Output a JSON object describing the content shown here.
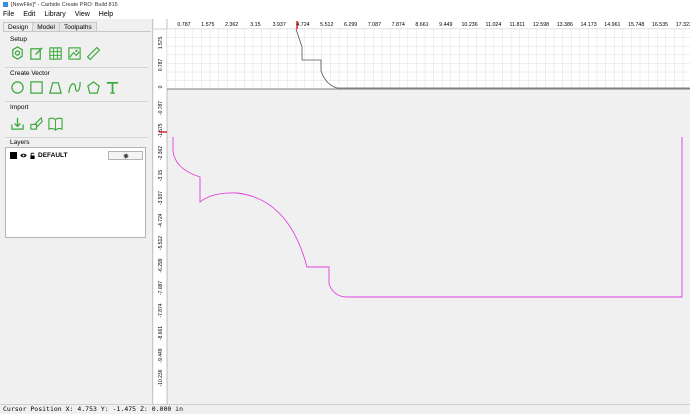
{
  "window": {
    "title": "[NewFile]* - Carbide Create PRO: Build 815"
  },
  "menu": [
    "File",
    "Edit",
    "Library",
    "View",
    "Help"
  ],
  "left_panel": {
    "tabs": [
      {
        "label": "Design",
        "active": true
      },
      {
        "label": "Model",
        "active": false
      },
      {
        "label": "Toolpaths",
        "active": false
      }
    ],
    "sections": {
      "setup": {
        "label": "Setup",
        "icons": [
          "job-setup-icon",
          "edit-icon",
          "grid-table-icon",
          "image-icon",
          "ruler-icon"
        ]
      },
      "create_vector": {
        "label": "Create Vector",
        "icons": [
          "circle-icon",
          "rectangle-icon",
          "polyline-icon",
          "curve-icon",
          "polygon-icon",
          "text-icon"
        ]
      },
      "import": {
        "label": "Import",
        "icons": [
          "import-icon",
          "trace-icon",
          "library-icon"
        ]
      },
      "layers": {
        "label": "Layers",
        "items": [
          {
            "name": "DEFAULT",
            "color": "#000000"
          }
        ]
      }
    }
  },
  "canvas": {
    "x_ruler_labels": [
      "0.787",
      "1.575",
      "2.362",
      "3.15",
      "3.937",
      "4.724",
      "5.512",
      "6.299",
      "7.087",
      "7.874",
      "8.661",
      "9.449",
      "10.236",
      "11.024",
      "11.811",
      "12.598",
      "13.386",
      "14.173",
      "14.961",
      "15.748",
      "16.535",
      "17.323"
    ],
    "y_ruler_labels_top": [
      "1.575",
      "0.787",
      "0"
    ],
    "y_ruler_labels_main": [
      "-0.787",
      "-1.575",
      "-2.362",
      "-3.15",
      "-3.937",
      "-4.724",
      "-5.512",
      "-6.299",
      "-7.087",
      "-7.874",
      "-8.661",
      "-9.449",
      "-10.236"
    ],
    "toolpath_color": "#e040e0",
    "profile_color": "#555555",
    "cursor_marker_color": "#e02020"
  },
  "status": {
    "text": "Cursor Position X: 4.753 Y: -1.475 Z: 0.000 in"
  }
}
